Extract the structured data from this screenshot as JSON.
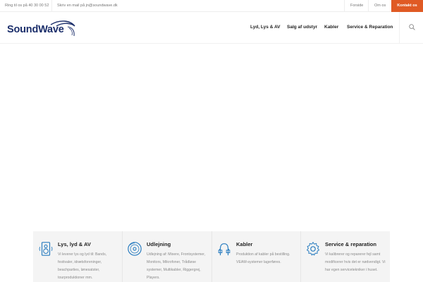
{
  "topbar": {
    "phone_text": "Ring til os på 40 30 00 52",
    "email_text": "Skriv en mail på jn@soundwave.dk",
    "link_frontpage": "Forside",
    "link_about": "Om os",
    "cta_label": "Kontakt os"
  },
  "brand": {
    "logo_text": "SoundWave",
    "brand_color": "#1c2f6b",
    "accent_color": "#e05a24"
  },
  "nav": {
    "items": [
      {
        "label": "Lyd, Lys & AV"
      },
      {
        "label": "Salg af udstyr"
      },
      {
        "label": "Kabler"
      },
      {
        "label": "Service & Reparation"
      }
    ],
    "search_icon": "search-icon"
  },
  "services": [
    {
      "icon": "speaker-icon",
      "title": "Lys, lyd & AV",
      "desc": "Vi leverer lys og lyd til: Bands, festivaler, idrætsforeninger, beachparties, lønesatster, tourproduktioner mm."
    },
    {
      "icon": "record-icon",
      "title": "Udlejning",
      "desc": "Udlejning af: Mixere, Frontsystemer, Monitors, Mikrofoner, Trådløse systemer, Multikabler, Riggergrej, Players."
    },
    {
      "icon": "cable-icon",
      "title": "Kabler",
      "desc": "Produktion af kabler på bestilling. VEAM-systemer lagerføres."
    },
    {
      "icon": "gear-icon",
      "title": "Service & reparation",
      "desc": "Vi kalibrerer og reparerer fejl samt modificerer hvis det er nødvendigt. Vi har egen servicetekniker i huset."
    }
  ]
}
